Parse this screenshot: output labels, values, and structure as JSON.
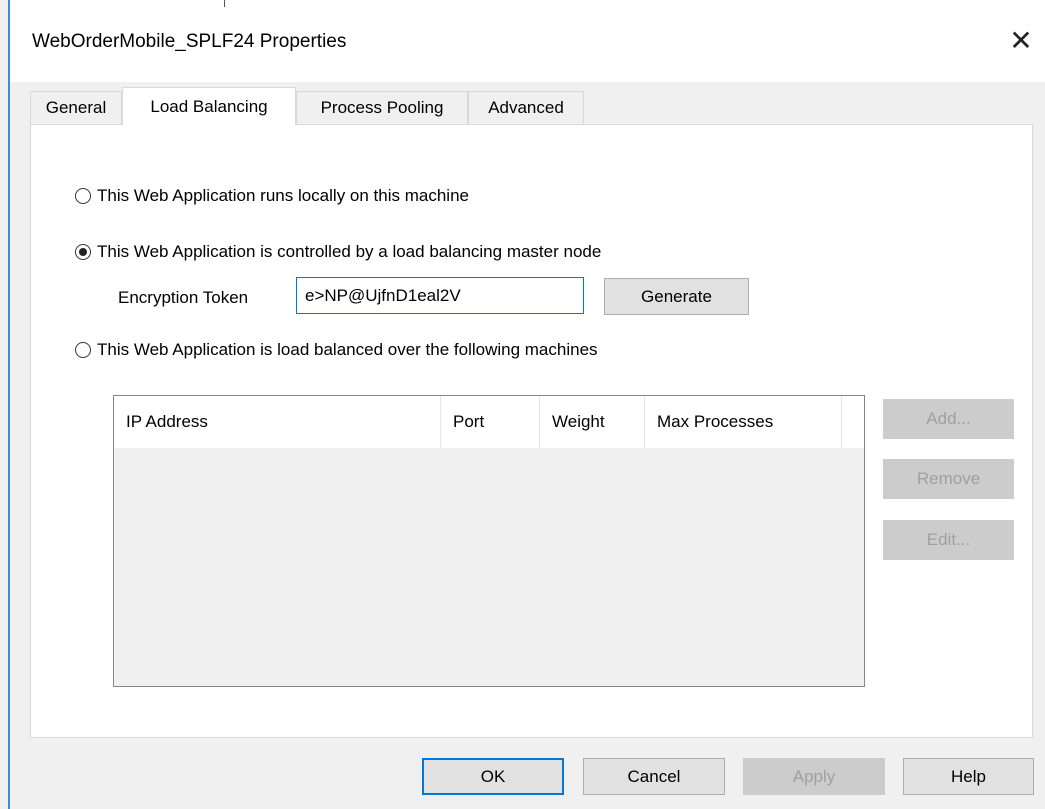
{
  "window": {
    "title": "WebOrderMobile_SPLF24 Properties",
    "close_glyph": "✕"
  },
  "tabs": [
    {
      "label": "General",
      "active": false
    },
    {
      "label": "Load Balancing",
      "active": true
    },
    {
      "label": "Process Pooling",
      "active": false
    },
    {
      "label": "Advanced",
      "active": false
    }
  ],
  "load_balancing": {
    "options": [
      {
        "label": "This Web Application runs locally on this machine",
        "checked": false
      },
      {
        "label": "This Web Application is controlled by a load balancing master node",
        "checked": true
      },
      {
        "label": "This Web Application is load balanced over the following machines",
        "checked": false
      }
    ],
    "encryption_token_label": "Encryption Token",
    "encryption_token_value": "e>NP@UjfnD1eal2V",
    "generate_label": "Generate",
    "table": {
      "columns": [
        "IP Address",
        "Port",
        "Weight",
        "Max Processes"
      ],
      "rows": []
    },
    "side_buttons": {
      "add": "Add...",
      "remove": "Remove",
      "edit": "Edit..."
    }
  },
  "footer": {
    "ok": "OK",
    "cancel": "Cancel",
    "apply": "Apply",
    "help": "Help"
  },
  "colors": {
    "accent": "#0078d7",
    "disabled_text": "#a0a0a0"
  }
}
